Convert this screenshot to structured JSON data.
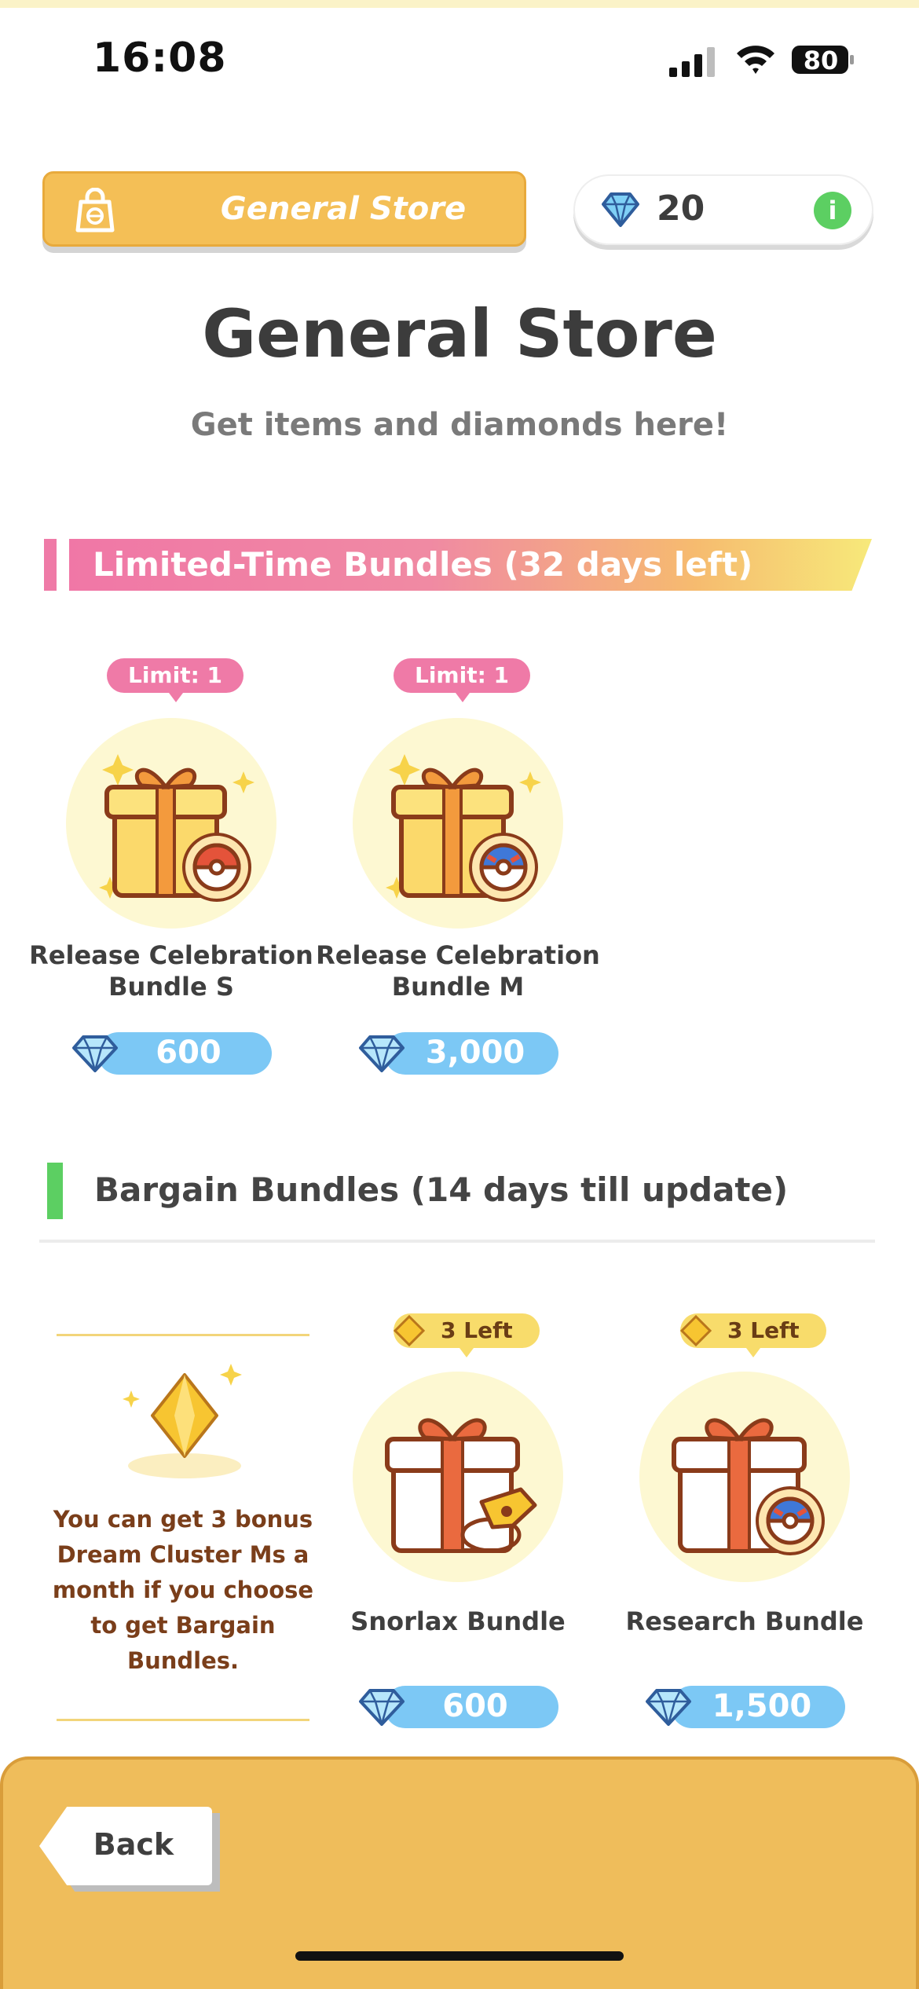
{
  "status_bar": {
    "time": "16:08",
    "battery": "80"
  },
  "header": {
    "store_button_label": "General Store",
    "diamond_count": "20",
    "info_icon": "info-icon"
  },
  "page": {
    "title": "General Store",
    "subtitle": "Get items and diamonds here!"
  },
  "limited_section": {
    "title": "Limited-Time Bundles (32 days left)",
    "items": [
      {
        "tag": "Limit: 1",
        "name_line1": "Release Celebration",
        "name_line2": "Bundle S",
        "price": "600",
        "ball": "poke-ball"
      },
      {
        "tag": "Limit: 1",
        "name_line1": "Release Celebration",
        "name_line2": "Bundle M",
        "price": "3,000",
        "ball": "great-ball"
      }
    ]
  },
  "bargain_section": {
    "title": "Bargain Bundles (14 days till update)",
    "info_text": "You can get 3 bonus Dream Cluster Ms a month if you choose to get Bargain Bundles.",
    "items": [
      {
        "tag": "3 Left",
        "name": "Snorlax Bundle",
        "price": "600"
      },
      {
        "tag": "3 Left",
        "name": "Research Bundle",
        "price": "1,500"
      }
    ]
  },
  "footer": {
    "back_label": "Back"
  },
  "colors": {
    "accent": "#f4bf56",
    "pink": "#ef7aa7",
    "green": "#5ccf62",
    "price": "#7cc8f5"
  }
}
